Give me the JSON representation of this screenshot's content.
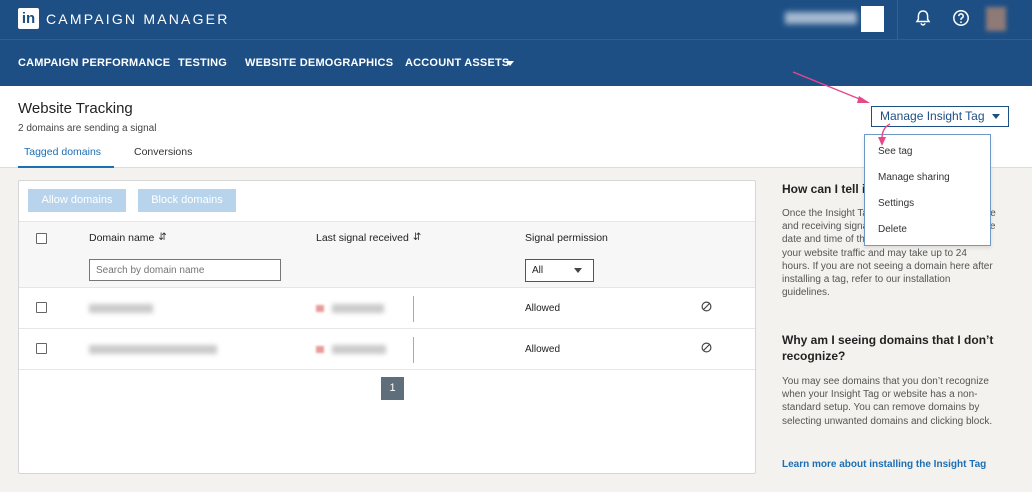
{
  "app": {
    "title": "CAMPAIGN MANAGER",
    "logo_text": "in"
  },
  "nav": {
    "items": [
      "CAMPAIGN PERFORMANCE",
      "TESTING",
      "WEBSITE DEMOGRAPHICS",
      "ACCOUNT ASSETS"
    ]
  },
  "page": {
    "title": "Website Tracking",
    "subtitle": "2 domains are sending a signal",
    "tabs": [
      "Tagged domains",
      "Conversions"
    ]
  },
  "insight": {
    "button_label": "Manage Insight Tag",
    "menu": [
      "See tag",
      "Manage sharing",
      "Settings",
      "Delete"
    ]
  },
  "table": {
    "allow_label": "Allow domains",
    "block_label": "Block domains",
    "columns": {
      "domain": "Domain name",
      "signal": "Last signal received",
      "permission": "Signal permission"
    },
    "search_placeholder": "Search by domain name",
    "filter_value": "All",
    "rows": [
      {
        "permission": "Allowed"
      },
      {
        "permission": "Allowed"
      }
    ],
    "page": "1"
  },
  "help": {
    "h1": "How can I tell if my tag is working?",
    "p1": "Once the Insight Tag is installed on your website and receiving signals, your domain will show the date and time of the last visit. This depends on your website traffic and may take up to 24 hours. If you are not seeing a domain here after installing a tag, refer to our installation guidelines.",
    "h2": "Why am I seeing domains that I don’t recognize?",
    "p2": "You may see domains that you don’t recognize when your Insight Tag or website has a non-standard setup. You can remove domains by selecting unwanted domains and clicking block.",
    "link": "Learn more about installing the Insight Tag"
  },
  "colors": {
    "brand": "#1d4f85",
    "link": "#1d6fb5",
    "annotation": "#e8478a"
  }
}
